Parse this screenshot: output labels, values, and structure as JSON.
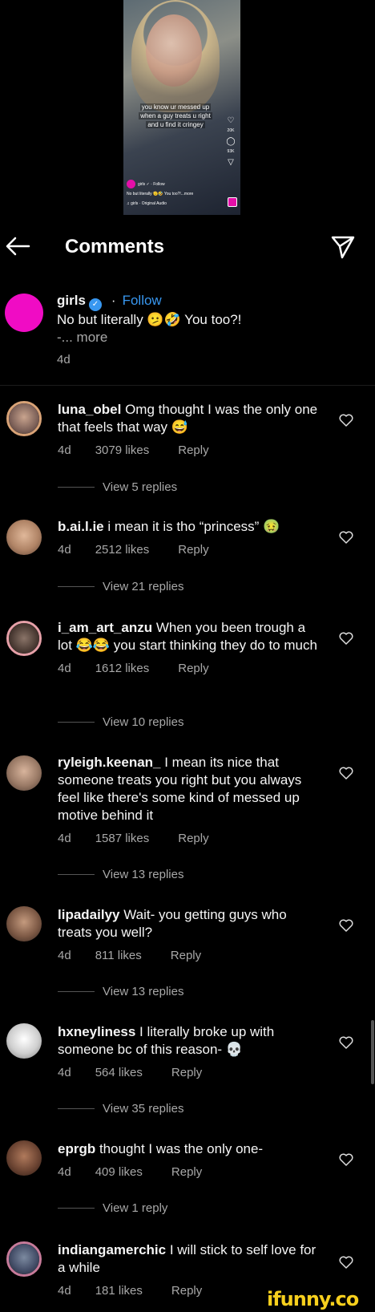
{
  "video": {
    "caption_lines": [
      "you know ur messed up",
      "when a guy treats u right",
      "and u find it cringey"
    ],
    "side_counts": [
      "20K",
      "93K"
    ],
    "user_line": "girls ✓ · Follow",
    "caption_short": "No but literally 🫡🤣 You too?!...more",
    "audio": "♫ girls · Original Audio"
  },
  "header": {
    "title": "Comments"
  },
  "post": {
    "username": "girls",
    "follow_label": "Follow",
    "text": "No but literally 🫤🤣 You too?!",
    "more": "-... more",
    "time": "4d"
  },
  "comments": [
    {
      "username": "luna_obel",
      "text": " Omg thought I was the only one that feels that way 😅",
      "time": "4d",
      "likes": "3079 likes",
      "reply": "Reply",
      "view_replies": "View 5 replies"
    },
    {
      "username": "b.ai.l.ie",
      "text": " i mean it is tho “princess” 🤢",
      "time": "4d",
      "likes": "2512 likes",
      "reply": "Reply",
      "view_replies": "View 21 replies"
    },
    {
      "username": "i_am_art_anzu",
      "text": " When you been trough a lot 😂😂 you start thinking they do to much",
      "time": "4d",
      "likes": "1612 likes",
      "reply": "Reply",
      "view_replies": "View 10 replies"
    },
    {
      "username": "ryleigh.keenan_",
      "text": " I mean its nice that someone treats you right but you always feel like there's some kind of messed up motive behind it",
      "time": "4d",
      "likes": "1587 likes",
      "reply": "Reply",
      "view_replies": "View 13 replies"
    },
    {
      "username": "lipadailyy",
      "text": " Wait- you getting guys who treats you well?",
      "time": "4d",
      "likes": "811 likes",
      "reply": "Reply",
      "view_replies": "View 13 replies"
    },
    {
      "username": "hxneyliness",
      "text": " I literally broke up with someone bc of this reason- 💀",
      "time": "4d",
      "likes": "564 likes",
      "reply": "Reply",
      "view_replies": "View 35 replies"
    },
    {
      "username": "eprgb",
      "text": " thought I was the only one-",
      "time": "4d",
      "likes": "409 likes",
      "reply": "Reply",
      "view_replies": "View 1 reply"
    },
    {
      "username": "indiangamerchic",
      "text": " I will stick to self love for a while",
      "time": "4d",
      "likes": "181 likes",
      "reply": "Reply"
    }
  ],
  "watermark": "ifunny.co"
}
